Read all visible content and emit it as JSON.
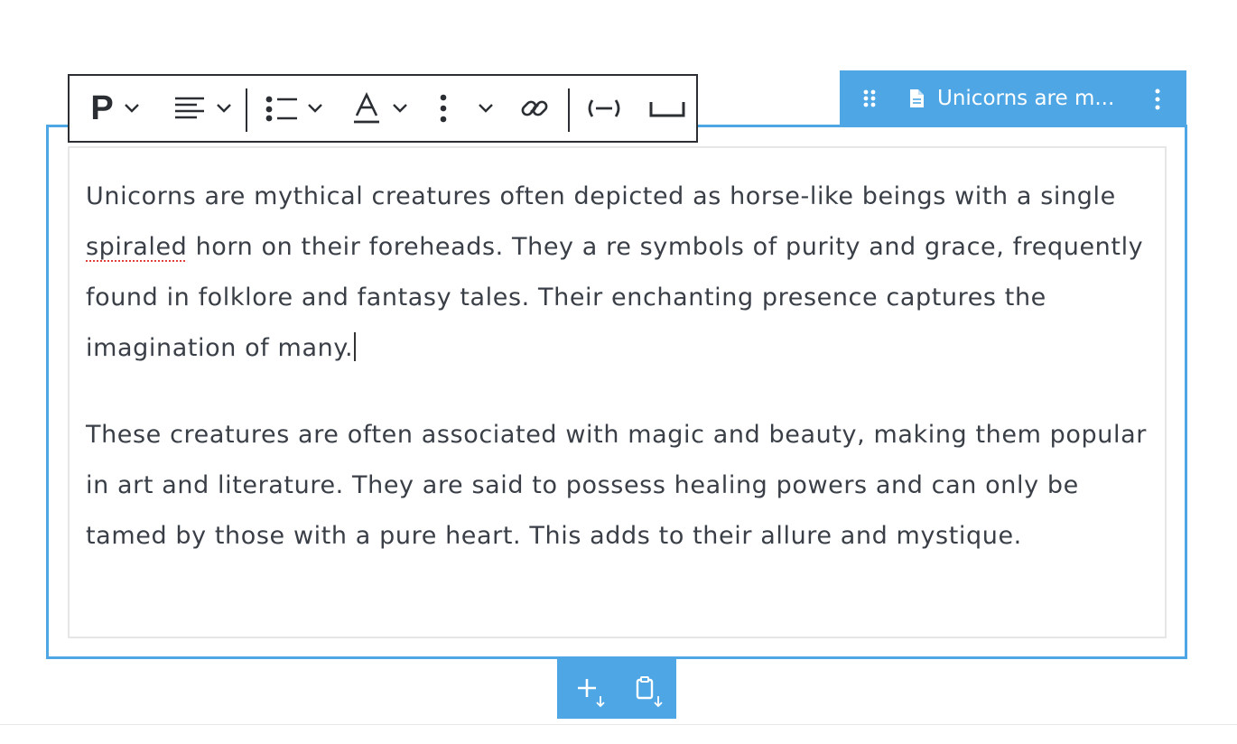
{
  "block_label": {
    "title": "Unicorns are m...",
    "drag_handle_icon": "drag-handle-icon",
    "document_icon": "document-icon",
    "more_icon": "vertical-ellipsis-icon"
  },
  "toolbar": {
    "paragraph_label": "P",
    "buttons": [
      "paragraph-format",
      "text-align",
      "list",
      "text-color",
      "more-options",
      "link",
      "nonbreaking-hyphen",
      "nonbreaking-space"
    ]
  },
  "content": {
    "p1_before": "Unicorns are mythical creatures often depicted as horse-like beings with a single ",
    "p1_misspelled": "spiraled",
    "p1_after": " horn on their foreheads. They a re symbols of purity and grace, frequently found in folklore and fantasy tales. Their enchanting presence captures the imagination of many.",
    "p2": "These creatures are often associated with magic and beauty, making them popular in art and literature. They are said to possess healing powers and can only be tamed by those with a pure heart. This adds to their allure and mystique."
  },
  "insert_bar": {
    "add_icon": "add-below-icon",
    "paste_icon": "paste-below-icon"
  },
  "colors": {
    "accent": "#4ea6e5",
    "text": "#3a3f47",
    "toolbar_border": "#2b2f33"
  }
}
